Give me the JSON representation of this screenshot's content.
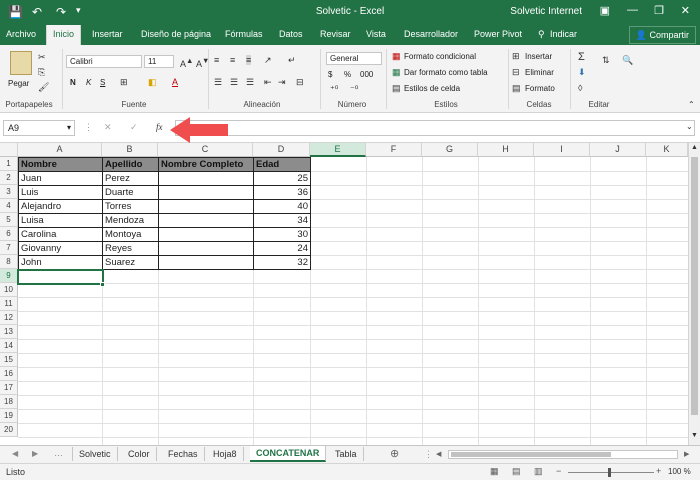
{
  "titlebar": {
    "title": "Solvetic  -  Excel",
    "account": "Solvetic Internet",
    "save_icon": "save-icon",
    "undo_icon": "undo-icon",
    "redo_icon": "redo-icon",
    "minimize": "—",
    "restore": "❐",
    "close": "✕"
  },
  "tabs": {
    "items": [
      "Archivo",
      "Inicio",
      "Insertar",
      "Diseño de página",
      "Fórmulas",
      "Datos",
      "Revisar",
      "Vista",
      "Desarrollador",
      "Power Pivot"
    ],
    "tell_me": "Indicar",
    "share": "Compartir"
  },
  "ribbon": {
    "clipboard": {
      "paste": "Pegar",
      "label": "Portapapeles"
    },
    "font": {
      "name": "Calibri",
      "size": "11",
      "bold": "N",
      "italic": "K",
      "underline": "S",
      "label": "Fuente"
    },
    "alignment": {
      "label": "Alineación"
    },
    "number": {
      "format": "General",
      "currency": "$",
      "percent": "%",
      "comma": "000",
      "label": "Número"
    },
    "styles": {
      "conditional": "Formato condicional",
      "as_table": "Dar formato como tabla",
      "cell_styles": "Estilos de celda",
      "label": "Estilos"
    },
    "cells": {
      "insert": "Insertar",
      "delete": "Eliminar",
      "format": "Formato",
      "label": "Celdas"
    },
    "editing": {
      "label": "Editar"
    }
  },
  "formula_bar": {
    "name_box": "A9",
    "cancel": "✕",
    "enter": "✓",
    "fx": "fx",
    "value": ""
  },
  "sheet": {
    "columns": [
      "A",
      "B",
      "C",
      "D",
      "E",
      "F",
      "G",
      "H",
      "I",
      "J",
      "K"
    ],
    "rows": [
      "1",
      "2",
      "3",
      "4",
      "5",
      "6",
      "7",
      "8",
      "9",
      "10",
      "11",
      "12",
      "13",
      "14",
      "15",
      "16",
      "17",
      "18",
      "19",
      "20"
    ],
    "headers": [
      "Nombre",
      "Apellido",
      "Nombre Completo",
      "Edad"
    ],
    "data": [
      {
        "nombre": "Juan",
        "apellido": "Perez",
        "edad": "25"
      },
      {
        "nombre": "Luis",
        "apellido": "Duarte",
        "edad": "36"
      },
      {
        "nombre": "Alejandro",
        "apellido": "Torres",
        "edad": "40"
      },
      {
        "nombre": "Luisa",
        "apellido": "Mendoza",
        "edad": "34"
      },
      {
        "nombre": "Carolina",
        "apellido": "Montoya",
        "edad": "30"
      },
      {
        "nombre": "Giovanny",
        "apellido": "Reyes",
        "edad": "24"
      },
      {
        "nombre": "John",
        "apellido": "Suarez",
        "edad": "32"
      }
    ]
  },
  "sheet_tabs": [
    "Solvetic",
    "Color",
    "Fechas",
    "Hoja8",
    "CONCATENAR",
    "Tabla"
  ],
  "status": {
    "ready": "Listo",
    "zoom": "100 %"
  },
  "colors": {
    "excel_green": "#217346",
    "arrow": "#f04e4e",
    "header_fill": "#8c8c8c"
  }
}
